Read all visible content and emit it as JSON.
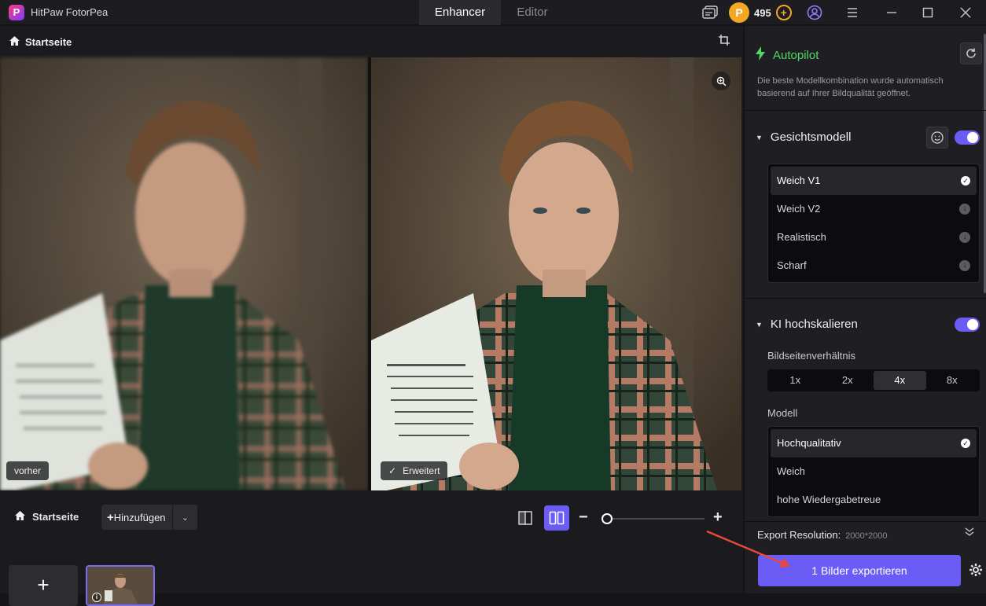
{
  "app": {
    "name": "HitPaw FotorPea",
    "logo_letter": "P"
  },
  "tabs": [
    {
      "label": "Enhancer",
      "active": true
    },
    {
      "label": "Editor",
      "active": false
    }
  ],
  "header": {
    "coins": "495",
    "coin_letter": "P"
  },
  "breadcrumb": {
    "label": "Startseite"
  },
  "preview": {
    "before_label": "vorher",
    "after_label": "Erweitert"
  },
  "bottombar": {
    "home_label": "Startseite",
    "add_label": "Hinzufügen",
    "add_tile": "+",
    "thumb_info": "i"
  },
  "zoom": {
    "minus": "−",
    "plus": "+",
    "level": 0.02
  },
  "autopilot": {
    "title": "Autopilot",
    "description": "Die beste Modellkombination wurde automatisch basierend auf Ihrer Bildqualität geöffnet."
  },
  "face_model": {
    "title": "Gesichtsmodell",
    "enabled": true,
    "options": [
      {
        "label": "Weich V1",
        "selected": true
      },
      {
        "label": "Weich V2",
        "selected": false
      },
      {
        "label": "Realistisch",
        "selected": false
      },
      {
        "label": "Scharf",
        "selected": false
      }
    ]
  },
  "upscale": {
    "title": "KI hochskalieren",
    "enabled": true,
    "ratio_label": "Bildseitenverhältnis",
    "ratios": [
      {
        "label": "1x",
        "active": false
      },
      {
        "label": "2x",
        "active": false
      },
      {
        "label": "4x",
        "active": true
      },
      {
        "label": "8x",
        "active": false
      }
    ],
    "model_label": "Modell",
    "models": [
      {
        "label": "Hochqualitativ",
        "selected": true
      },
      {
        "label": "Weich",
        "selected": false
      },
      {
        "label": "hohe Wiedergabetreue",
        "selected": false
      }
    ]
  },
  "export": {
    "res_label": "Export Resolution:",
    "res_value": "2000*2000",
    "button_label": "1 Bilder exportieren"
  },
  "colors": {
    "accent": "#6b5cf6",
    "autopilot": "#4cd964",
    "coin": "#f5a623"
  }
}
